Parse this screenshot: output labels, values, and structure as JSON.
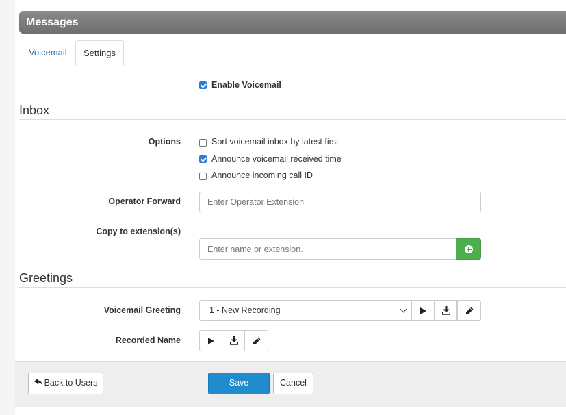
{
  "header": {
    "title": "Messages"
  },
  "tabs": [
    {
      "label": "Voicemail",
      "active": false
    },
    {
      "label": "Settings",
      "active": true
    }
  ],
  "enable_voicemail": {
    "label": "Enable Voicemail",
    "checked": true
  },
  "inbox": {
    "title": "Inbox",
    "options_label": "Options",
    "options": [
      {
        "label": "Sort voicemail inbox by latest first",
        "checked": false
      },
      {
        "label": "Announce voicemail received time",
        "checked": true
      },
      {
        "label": "Announce incoming call ID",
        "checked": false
      }
    ],
    "operator_forward": {
      "label": "Operator Forward",
      "placeholder": "Enter Operator Extension",
      "value": ""
    },
    "copy_to": {
      "label": "Copy to extension(s)",
      "placeholder": "Enter name or extension.",
      "value": ""
    }
  },
  "greetings": {
    "title": "Greetings",
    "voicemail_greeting": {
      "label": "Voicemail Greeting",
      "selected": "1 - New Recording"
    },
    "recorded_name": {
      "label": "Recorded Name"
    }
  },
  "footer": {
    "back_label": "Back to Users",
    "save_label": "Save",
    "cancel_label": "Cancel"
  },
  "colors": {
    "primary": "#1f8dcd",
    "success": "#4cae4c",
    "checkbox": "#2e7bd6",
    "link": "#2a6fb0",
    "header": "#777777"
  }
}
